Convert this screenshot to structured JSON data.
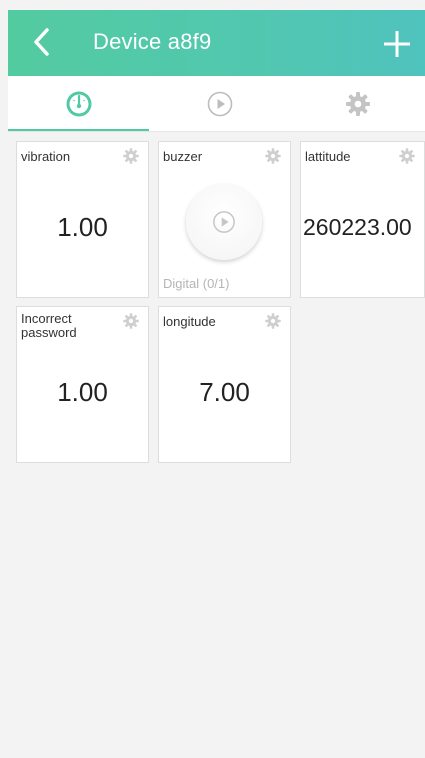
{
  "header": {
    "title": "Device a8f9",
    "back_icon": "chevron-left-icon",
    "add_icon": "plus-icon",
    "color": "#53cba0"
  },
  "tabs": [
    {
      "name": "dashboard",
      "icon": "gauge-icon",
      "active": true
    },
    {
      "name": "controls",
      "icon": "play-circle-icon",
      "active": false
    },
    {
      "name": "settings",
      "icon": "gear-icon",
      "active": false
    }
  ],
  "widgets": {
    "vibration": {
      "label": "vibration",
      "value": "1.00"
    },
    "buzzer": {
      "label": "buzzer",
      "mode": "Digital (0/1)"
    },
    "lattitude": {
      "label": "lattitude",
      "value": "260223.00"
    },
    "incorrect_password": {
      "label_line1": "Incorrect",
      "label_line2": "password",
      "value": "1.00"
    },
    "longitude": {
      "label": "longitude",
      "value": "7.00"
    }
  }
}
